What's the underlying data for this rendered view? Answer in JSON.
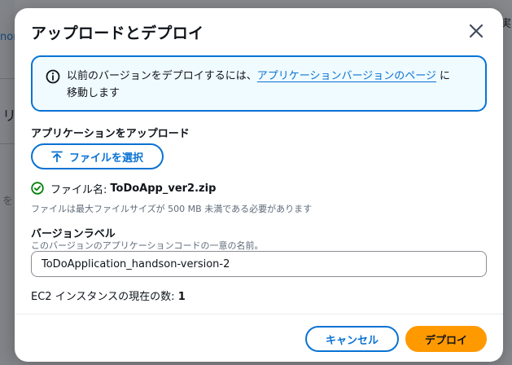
{
  "background": {
    "fragments": [
      "nor",
      "リ",
      "を"
    ],
    "right_fragment": "実"
  },
  "modal": {
    "title": "アップロードとデプロイ",
    "close_icon": "close-icon",
    "alert": {
      "icon": "info-icon",
      "text_before": "以前のバージョンをデプロイするには、",
      "link": "アプリケーションバージョンのページ",
      "text_after": "に移動します"
    },
    "upload": {
      "label": "アプリケーションをアップロード",
      "button_label": "ファイルを選択",
      "button_icon": "upload-arrow-icon",
      "status_icon": "check-circle-icon",
      "file_name_label": "ファイル名:",
      "file_name": "ToDoApp_ver2.zip",
      "hint": "ファイルは最大ファイルサイズが 500 MB 未満である必要があります"
    },
    "version": {
      "label": "バージョンラベル",
      "description": "このバージョンのアプリケーションコードの一意の名前。",
      "value": "ToDoApplication_handson-version-2"
    },
    "ec2": {
      "label": "EC2 インスタンスの現在の数:",
      "count": "1"
    },
    "footer": {
      "cancel_label": "キャンセル",
      "deploy_label": "デプロイ"
    }
  },
  "colors": {
    "accent": "#0972d3",
    "primary_button": "#ff9900",
    "success": "#037f0c",
    "alert_bg": "#f0fbff"
  }
}
